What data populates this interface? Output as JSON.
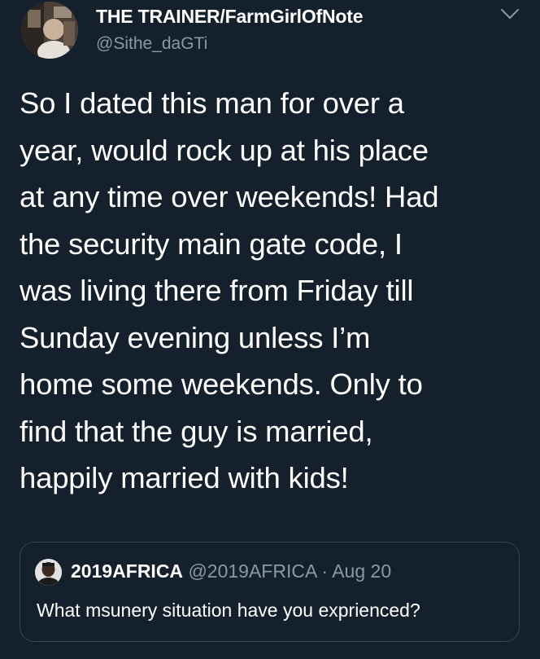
{
  "tweet": {
    "display_name": "THE TRAINER/FarmGirlOfNote",
    "handle": "@Sithe_daGTi",
    "text_lines": [
      "So I dated this man for over a",
      "year, would rock up at his place",
      "at any time over weekends! Had",
      "the security main gate code, I",
      "was living there from Friday till",
      "Sunday evening unless I’m",
      "home some weekends. Only to",
      "find that the guy is married,",
      "happily married with kids!"
    ],
    "menu_icon": "chevron-down-icon"
  },
  "quoted_tweet": {
    "display_name": "2019AFRICA",
    "handle": "@2019AFRICA",
    "separator": "·",
    "date": "Aug 20",
    "text": "What msunery situation have you exprienced?"
  },
  "colors": {
    "background": "#14202b",
    "primary_text": "#ffffff",
    "secondary_text": "#8b98a5",
    "border": "#38444d"
  }
}
